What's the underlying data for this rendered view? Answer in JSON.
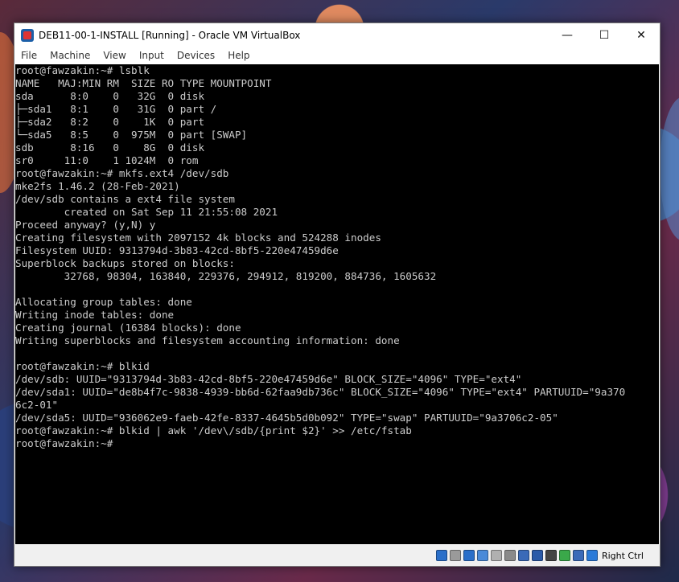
{
  "window": {
    "title": "DEB11-00-1-INSTALL [Running] - Oracle VM VirtualBox",
    "minimize": "—",
    "maximize": "☐",
    "close": "✕"
  },
  "menu": [
    "File",
    "Machine",
    "View",
    "Input",
    "Devices",
    "Help"
  ],
  "terminal": {
    "lines": [
      "root@fawzakin:~# lsblk",
      "NAME   MAJ:MIN RM  SIZE RO TYPE MOUNTPOINT",
      "sda      8:0    0   32G  0 disk",
      "├─sda1   8:1    0   31G  0 part /",
      "├─sda2   8:2    0    1K  0 part",
      "└─sda5   8:5    0  975M  0 part [SWAP]",
      "sdb      8:16   0    8G  0 disk",
      "sr0     11:0    1 1024M  0 rom",
      "root@fawzakin:~# mkfs.ext4 /dev/sdb",
      "mke2fs 1.46.2 (28-Feb-2021)",
      "/dev/sdb contains a ext4 file system",
      "        created on Sat Sep 11 21:55:08 2021",
      "Proceed anyway? (y,N) y",
      "Creating filesystem with 2097152 4k blocks and 524288 inodes",
      "Filesystem UUID: 9313794d-3b83-42cd-8bf5-220e47459d6e",
      "Superblock backups stored on blocks:",
      "        32768, 98304, 163840, 229376, 294912, 819200, 884736, 1605632",
      "",
      "Allocating group tables: done",
      "Writing inode tables: done",
      "Creating journal (16384 blocks): done",
      "Writing superblocks and filesystem accounting information: done",
      "",
      "root@fawzakin:~# blkid",
      "/dev/sdb: UUID=\"9313794d-3b83-42cd-8bf5-220e47459d6e\" BLOCK_SIZE=\"4096\" TYPE=\"ext4\"",
      "/dev/sda1: UUID=\"de8b4f7c-9838-4939-bb6d-62faa9db736c\" BLOCK_SIZE=\"4096\" TYPE=\"ext4\" PARTUUID=\"9a370",
      "6c2-01\"",
      "/dev/sda5: UUID=\"936062e9-faeb-42fe-8337-4645b5d0b092\" TYPE=\"swap\" PARTUUID=\"9a3706c2-05\"",
      "root@fawzakin:~# blkid | awk '/dev\\/sdb/{print $2}' >> /etc/fstab",
      "root@fawzakin:~#"
    ]
  },
  "statusbar": {
    "icons": [
      {
        "name": "hard-disk-icon",
        "color": "#2a6fc9"
      },
      {
        "name": "optical-drive-icon",
        "color": "#9a9a9a"
      },
      {
        "name": "audio-icon",
        "color": "#2a6fc9"
      },
      {
        "name": "network-icon",
        "color": "#4a8ad8"
      },
      {
        "name": "usb-icon",
        "color": "#b0b0b0"
      },
      {
        "name": "shared-folders-icon",
        "color": "#8a8a8a"
      },
      {
        "name": "display-icon",
        "color": "#3a6ab8"
      },
      {
        "name": "video-capture-icon",
        "color": "#2a5aa8"
      },
      {
        "name": "recording-icon",
        "color": "#444444"
      },
      {
        "name": "guest-additions-icon",
        "color": "#3aa84a"
      },
      {
        "name": "cpu-icon",
        "color": "#3a6ab8"
      },
      {
        "name": "mouse-integration-icon",
        "color": "#2a7ad8"
      }
    ],
    "host_key": "Right Ctrl"
  }
}
